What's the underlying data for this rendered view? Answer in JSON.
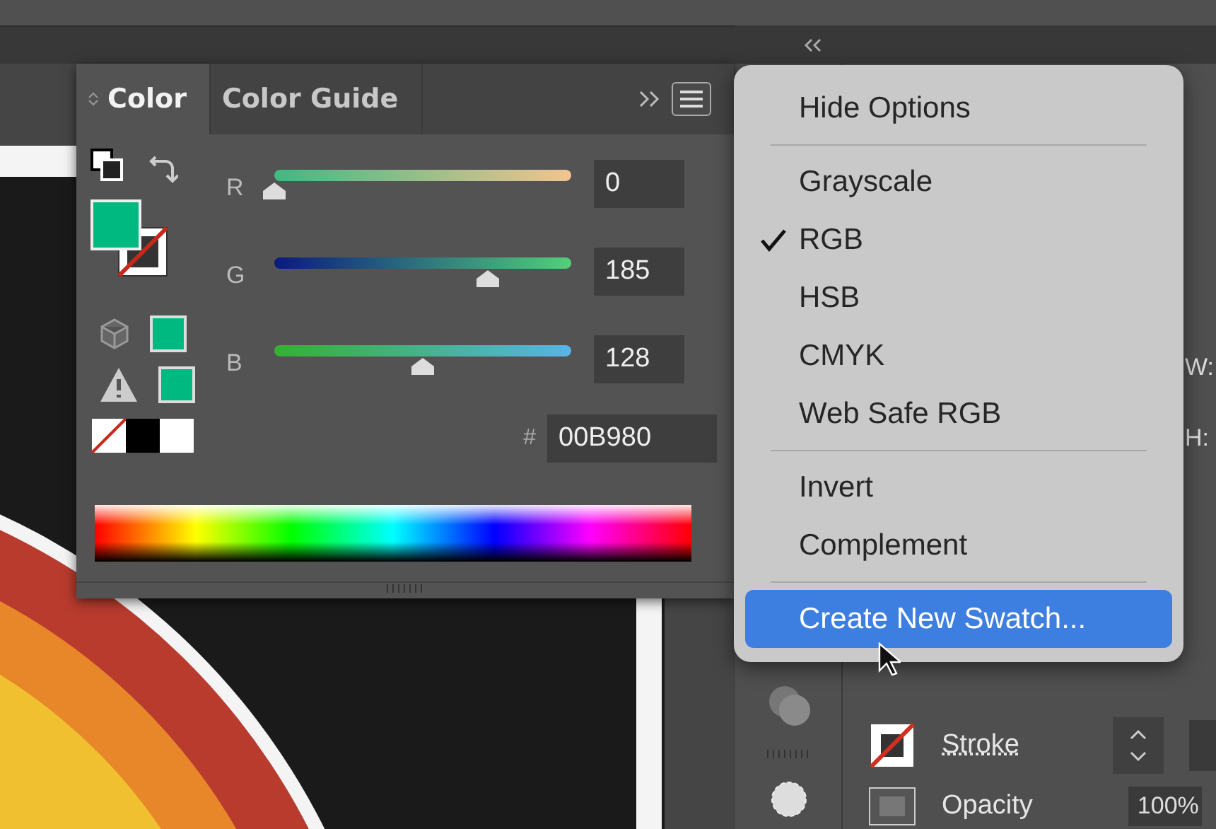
{
  "color_panel": {
    "tabs": [
      {
        "label": "Color",
        "selected": true
      },
      {
        "label": "Color Guide",
        "selected": false
      }
    ],
    "sliders": [
      {
        "label": "R",
        "level": 0,
        "value": "0"
      },
      {
        "label": "G",
        "level": 0.72,
        "value": "185"
      },
      {
        "label": "B",
        "level": 0.5,
        "value": "128"
      }
    ],
    "hex_label": "#",
    "hex_value": "00B980"
  },
  "menu": {
    "groups": [
      {
        "items": [
          {
            "label": "Hide Options",
            "checked": false,
            "selected": false
          }
        ]
      },
      {
        "items": [
          {
            "label": "Grayscale",
            "checked": false,
            "selected": false
          },
          {
            "label": "RGB",
            "checked": true,
            "selected": false
          },
          {
            "label": "HSB",
            "checked": false,
            "selected": false
          },
          {
            "label": "CMYK",
            "checked": false,
            "selected": false
          },
          {
            "label": "Web Safe RGB",
            "checked": false,
            "selected": false
          }
        ]
      },
      {
        "items": [
          {
            "label": "Invert",
            "checked": false,
            "selected": false
          },
          {
            "label": "Complement",
            "checked": false,
            "selected": false
          }
        ]
      },
      {
        "items": [
          {
            "label": "Create New Swatch...",
            "checked": false,
            "selected": true
          }
        ]
      }
    ]
  },
  "properties": {
    "w_label": "W:",
    "h_label": "H:",
    "stroke_label": "Stroke",
    "opacity_label": "Opacity",
    "opacity_value": "100%"
  }
}
